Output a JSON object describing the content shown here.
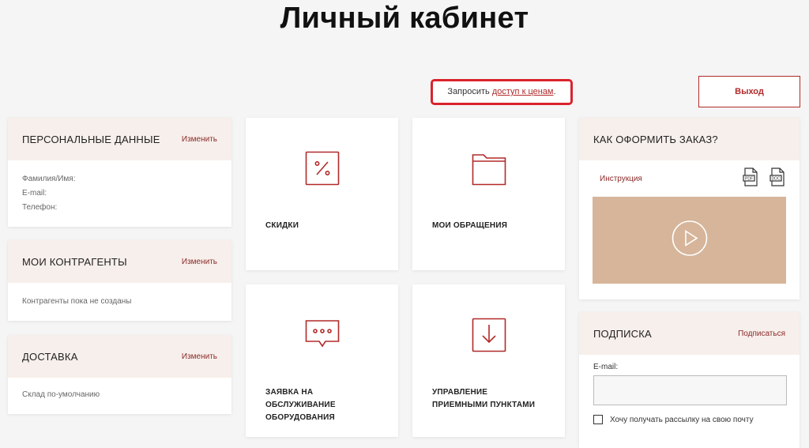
{
  "page": {
    "title": "Личный кабинет"
  },
  "header": {
    "request_text": "Запросить ",
    "request_link": "доступ к ценам",
    "request_end": ".",
    "logout": "Выход"
  },
  "personal": {
    "title": "ПЕРСОНАЛЬНЫЕ ДАННЫЕ",
    "action": "Изменить",
    "fields": [
      "Фамилия/Имя:",
      "E-mail:",
      "Телефон:"
    ]
  },
  "contractors": {
    "title": "МОИ КОНТРАГЕНТЫ",
    "action": "Изменить",
    "empty": "Контрагенты пока не созданы"
  },
  "delivery": {
    "title": "ДОСТАВКА",
    "action": "Изменить",
    "warehouse": "Склад по-умолчанию"
  },
  "tiles": [
    {
      "label": "СКИДКИ",
      "icon": "percent-icon"
    },
    {
      "label": "МОИ ОБРАЩЕНИЯ",
      "icon": "folder-icon"
    },
    {
      "label_lines": [
        "ЗАЯВКА НА",
        "ОБСЛУЖИВАНИЕ",
        "ОБОРУДОВАНИЯ"
      ],
      "icon": "chat-bubble-icon"
    },
    {
      "label_lines": [
        "УПРАВЛЕНИЕ",
        "ПРИЕМНЫМИ ПУНКТАМИ"
      ],
      "icon": "download-box-icon"
    }
  ],
  "how_to": {
    "title": "КАК ОФОРМИТЬ ЗАКАЗ?",
    "instruction": "Инструкция",
    "files": [
      "PDF",
      "DOC"
    ]
  },
  "subscription": {
    "title": "ПОДПИСКА",
    "action": "Подписаться",
    "email_label": "E-mail:",
    "email_value": "",
    "checkbox_label": "Хочу получать рассылку на свою почту"
  },
  "colors": {
    "accent": "#b22a2a",
    "head_bg": "#f7efeb",
    "video_bg": "#d6b59a",
    "highlight": "#d9232d"
  }
}
